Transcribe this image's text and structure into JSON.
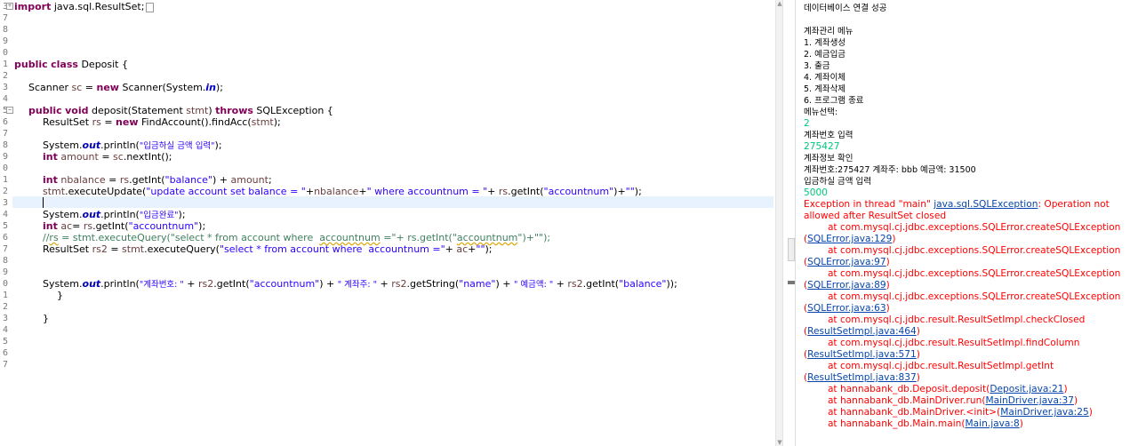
{
  "editor": {
    "line_numbers": [
      "3",
      "7",
      "8",
      "9",
      "0",
      "1",
      "2",
      "3",
      "4",
      "5",
      "6",
      "7",
      "8",
      "9",
      "0",
      "1",
      "2",
      "3",
      "4",
      "5",
      "6",
      "7",
      "8",
      "9",
      "0",
      "1",
      "2",
      "3",
      "4",
      "5",
      "6",
      "7"
    ],
    "code": {
      "l0_kw": "import",
      "l0_rest": " java.sql.ResultSet;",
      "l5_kw1": "public",
      "l5_kw2": "class",
      "l5_rest": " Deposit {",
      "l7_a": "Scanner ",
      "l7_var": "sc",
      "l7_b": " = ",
      "l7_kw": "new",
      "l7_c": " Scanner(System.",
      "l7_fld": "in",
      "l7_d": ");",
      "l9_kw1": "public",
      "l9_kw2": "void",
      "l9_a": " deposit(Statement ",
      "l9_var": "stmt",
      "l9_b": ") ",
      "l9_kw3": "throws",
      "l9_c": " SQLException {",
      "l10_a": "ResultSet ",
      "l10_var": "rs",
      "l10_b": " = ",
      "l10_kw": "new",
      "l10_c": " FindAccount().findAcc(",
      "l10_var2": "stmt",
      "l10_d": ");",
      "l12_a": "System.",
      "l12_fld": "out",
      "l12_b": ".println(",
      "l12_str": "\"입금하실 금액 입력\"",
      "l12_c": ");",
      "l13_kw": "int",
      "l13_a": " ",
      "l13_var": "amount",
      "l13_b": " = ",
      "l13_var2": "sc",
      "l13_c": ".nextInt();",
      "l15_kw": "int",
      "l15_a": " ",
      "l15_var": "nbalance",
      "l15_b": " = ",
      "l15_var2": "rs",
      "l15_c": ".getInt(",
      "l15_str": "\"balance\"",
      "l15_d": ") + ",
      "l15_var3": "amount",
      "l15_e": ";",
      "l16_var": "stmt",
      "l16_a": ".executeUpdate(",
      "l16_str1": "\"update account set balance = \"",
      "l16_b": "+",
      "l16_var2": "nbalance",
      "l16_c": "+",
      "l16_str2": "\" where accountnum = \"",
      "l16_d": "+ ",
      "l16_var3": "rs",
      "l16_e": ".getInt(",
      "l16_str3": "\"accountnum\"",
      "l16_f": ")+",
      "l16_str4": "\"\"",
      "l16_g": ");",
      "l18_a": "System.",
      "l18_fld": "out",
      "l18_b": ".println(",
      "l18_str": "\"입금완료\"",
      "l18_c": ");",
      "l19_kw": "int",
      "l19_a": " ",
      "l19_var": "ac",
      "l19_b": "= ",
      "l19_var2": "rs",
      "l19_c": ".getInt(",
      "l19_str": "\"accountnum\"",
      "l19_d": ");",
      "l20_a": "//",
      "l20_sq1": "rs",
      "l20_b": " = stmt.executeQuery(\"select * from account where  ",
      "l20_sq2": "accountnum",
      "l20_c": " =\"+ rs.getInt(\"",
      "l20_sq3": "accountnum",
      "l20_d": "\")+\"\");",
      "l21_a": "ResultSet ",
      "l21_var": "rs2",
      "l21_b": " = ",
      "l21_var2": "stmt",
      "l21_c": ".executeQuery(",
      "l21_str1": "\"select * from account where  accountnum =\"",
      "l21_d": "+ ",
      "l21_var3": "ac",
      "l21_e": "+",
      "l21_str2": "\"\"",
      "l21_f": ");",
      "l24_a": "System.",
      "l24_fld": "out",
      "l24_b": ".println(",
      "l24_str1": "\"계좌번호: \"",
      "l24_c": " + ",
      "l24_var1": "rs2",
      "l24_d": ".getInt(",
      "l24_str2": "\"accountnum\"",
      "l24_e": ") + ",
      "l24_str3": "\" 계좌주: \"",
      "l24_f": " + ",
      "l24_var2": "rs2",
      "l24_g": ".getString(",
      "l24_str4": "\"name\"",
      "l24_h": ") + ",
      "l24_str5": "\" 예금액: \"",
      "l24_i": " + ",
      "l24_var3": "rs2",
      "l24_j": ".getInt(",
      "l24_str6": "\"balance\"",
      "l24_k": "));",
      "l25": "}",
      "l27": "}"
    }
  },
  "console": {
    "line0": "데이터베이스 연결 성공",
    "line2": "계좌관리 메뉴",
    "line3": "1. 계좌생성",
    "line4": "2. 예금입금",
    "line5": "3. 출금",
    "line6": "4. 계좌이체",
    "line7": "5. 계좌삭제",
    "line8": "6. 프로그램 종료",
    "line9": "메뉴선택:",
    "line10": "2",
    "line11": "계좌번호 입력",
    "line12": "275427",
    "line13": "계좌정보 확인",
    "line14": "계좌번호:275427 계좌주: bbb 예금액: 31500",
    "line15": "입금하실 금액 입력",
    "line16": "5000",
    "line17_a": "Exception in thread \"main\" ",
    "line17_link": "java.sql.SQLException",
    "line17_b": ": Operation not",
    "line18": "allowed after ResultSet closed",
    "trace": [
      {
        "at": "        at com.mysql.cj.jdbc.exceptions.SQLError.createSQLException",
        "link": "SQLError.java:129"
      },
      {
        "at": "        at com.mysql.cj.jdbc.exceptions.SQLError.createSQLException",
        "link": "SQLError.java:97"
      },
      {
        "at": "        at com.mysql.cj.jdbc.exceptions.SQLError.createSQLException",
        "link": "SQLError.java:89"
      },
      {
        "at": "        at com.mysql.cj.jdbc.exceptions.SQLError.createSQLException",
        "link": "SQLError.java:63"
      },
      {
        "at": "        at com.mysql.cj.jdbc.result.ResultSetImpl.checkClosed",
        "link": "ResultSetImpl.java:464"
      },
      {
        "at": "        at com.mysql.cj.jdbc.result.ResultSetImpl.findColumn",
        "link": "ResultSetImpl.java:571"
      },
      {
        "at": "        at com.mysql.cj.jdbc.result.ResultSetImpl.getInt",
        "link": "ResultSetImpl.java:837"
      }
    ],
    "frames": [
      {
        "at": "        at hannabank_db.Deposit.deposit(",
        "link": "Deposit.java:21",
        "end": ")"
      },
      {
        "at": "        at hannabank_db.MainDriver.run(",
        "link": "MainDriver.java:37",
        "end": ")"
      },
      {
        "at": "        at hannabank_db.MainDriver.<init>(",
        "link": "MainDriver.java:25",
        "end": ")"
      },
      {
        "at": "        at hannabank_db.Main.main(",
        "link": "Main.java:8",
        "end": ")"
      }
    ]
  }
}
